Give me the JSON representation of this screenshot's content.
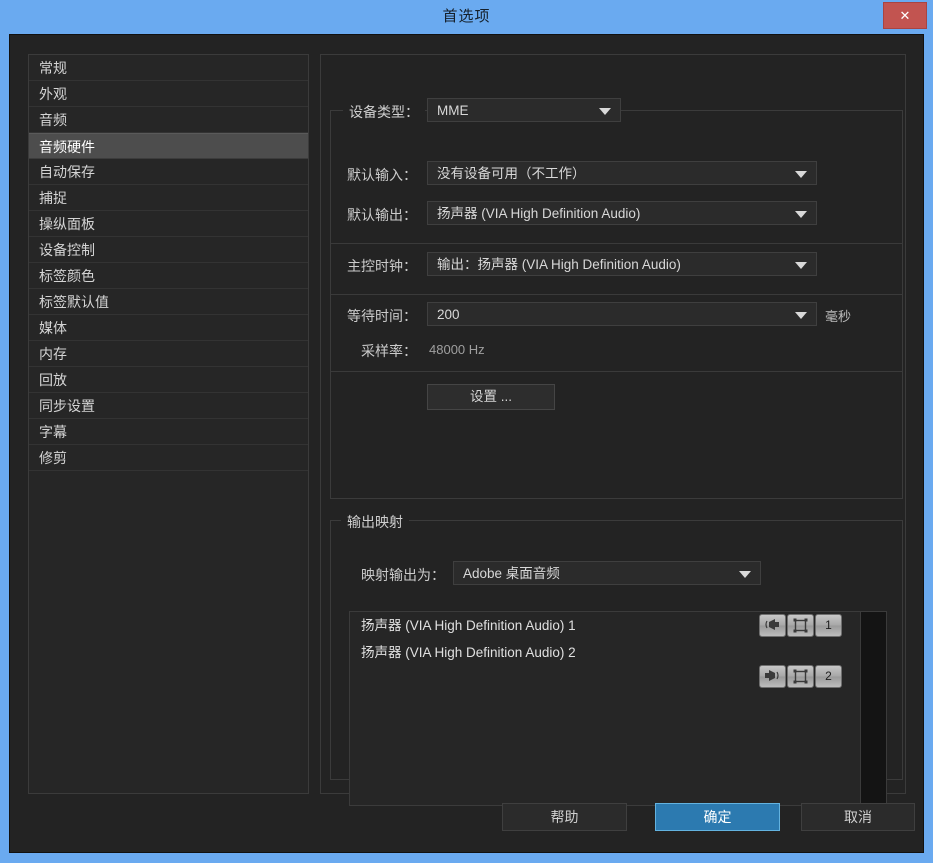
{
  "window": {
    "title": "首选项",
    "close_label": "✕",
    "accent_blue": "#6aaaf0",
    "close_red": "#c25450"
  },
  "sidebar": {
    "items": [
      {
        "label": "常规",
        "selected": false
      },
      {
        "label": "外观",
        "selected": false
      },
      {
        "label": "音频",
        "selected": false
      },
      {
        "label": "音频硬件",
        "selected": true
      },
      {
        "label": "自动保存",
        "selected": false
      },
      {
        "label": "捕捉",
        "selected": false
      },
      {
        "label": "操纵面板",
        "selected": false
      },
      {
        "label": "设备控制",
        "selected": false
      },
      {
        "label": "标签颜色",
        "selected": false
      },
      {
        "label": "标签默认值",
        "selected": false
      },
      {
        "label": "媒体",
        "selected": false
      },
      {
        "label": "内存",
        "selected": false
      },
      {
        "label": "回放",
        "selected": false
      },
      {
        "label": "同步设置",
        "selected": false
      },
      {
        "label": "字幕",
        "selected": false
      },
      {
        "label": "修剪",
        "selected": false
      }
    ]
  },
  "device_group": {
    "legend": "设备类型：",
    "device_type_value": "MME",
    "fields": [
      {
        "label": "默认输入：",
        "value": "没有设备可用（不工作）"
      },
      {
        "label": "默认输出：",
        "value": "扬声器 (VIA High Definition Audio)"
      },
      {
        "label": "主控时钟：",
        "value": "输出：扬声器 (VIA High Definition Audio)"
      },
      {
        "label": "等待时间：",
        "value": "200"
      }
    ],
    "latency_unit": "毫秒",
    "sample_rate_label": "采样率：",
    "sample_rate_value": "48000 Hz",
    "settings_button": "设置 ..."
  },
  "mapping_group": {
    "legend": "输出映射",
    "map_label": "映射输出为：",
    "map_value": "Adobe 桌面音频",
    "devices": [
      {
        "name": "扬声器 (VIA High Definition Audio) 1",
        "channel": "1"
      },
      {
        "name": "扬声器 (VIA High Definition Audio) 2",
        "channel": "2"
      }
    ]
  },
  "footer": {
    "help": "帮助",
    "ok": "确定",
    "cancel": "取消"
  }
}
